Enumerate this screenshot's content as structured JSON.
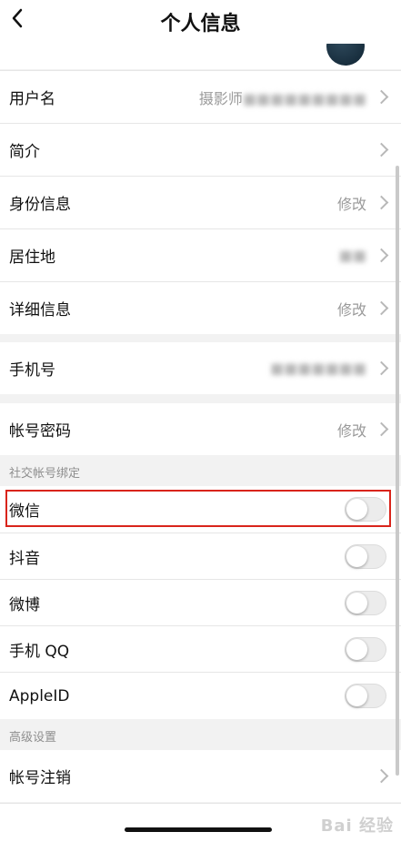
{
  "header": {
    "title": "个人信息",
    "back_icon": "back-arrow-icon"
  },
  "profile_rows": [
    {
      "label": "用户名",
      "value": "摄影师",
      "value_blurred": ""
    },
    {
      "label": "简介",
      "value": ""
    },
    {
      "label": "身份信息",
      "value": "修改"
    },
    {
      "label": "居住地",
      "value": ""
    },
    {
      "label": "详细信息",
      "value": "修改"
    }
  ],
  "phone_row": {
    "label": "手机号",
    "value": ""
  },
  "password_row": {
    "label": "帐号密码",
    "value": "修改"
  },
  "social": {
    "header": "社交帐号绑定",
    "items": [
      {
        "label": "微信",
        "enabled": false,
        "highlighted": true
      },
      {
        "label": "抖音",
        "enabled": false
      },
      {
        "label": "微博",
        "enabled": false
      },
      {
        "label": "手机 QQ",
        "enabled": false
      },
      {
        "label": "AppleID",
        "enabled": false
      }
    ]
  },
  "advanced": {
    "header": "高级设置",
    "items": [
      {
        "label": "帐号注销"
      }
    ]
  },
  "watermark": "Bai 经验",
  "colors": {
    "highlight": "#d9241b",
    "background": "#f2f2f2"
  }
}
